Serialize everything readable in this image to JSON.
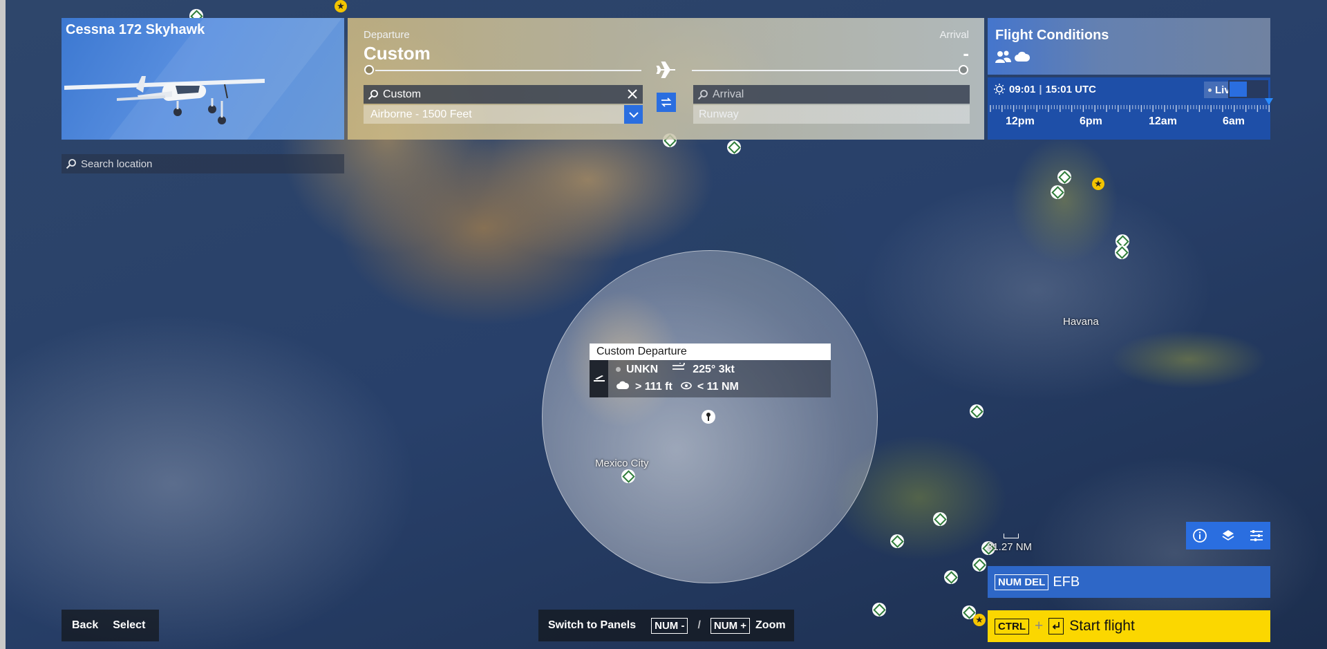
{
  "aircraft": {
    "name": "Cessna 172 Skyhawk"
  },
  "search": {
    "placeholder": "Search location"
  },
  "flight_plan": {
    "departure_label": "Departure",
    "departure_value": "Custom",
    "arrival_label": "Arrival",
    "arrival_value": "-",
    "departure_input_value": "Custom",
    "departure_start": "Airborne - 1500 Feet",
    "arrival_placeholder": "Arrival",
    "arrival_runway": "Runway"
  },
  "conditions": {
    "title": "Flight Conditions",
    "local_time": "09:01",
    "utc_time": "15:01 UTC",
    "live_label": "Live",
    "time_ticks": [
      "12pm",
      "6pm",
      "12am",
      "6am"
    ]
  },
  "popup": {
    "title": "Custom Departure",
    "station": "UNKN",
    "wind": "225° 3kt",
    "ceiling": "> 111 ft",
    "visibility": "< 11 NM"
  },
  "map": {
    "city_mexico": "Mexico City",
    "city_havana": "Havana",
    "scale": "31.27 NM"
  },
  "efb": {
    "key": "NUM DEL",
    "label": "EFB"
  },
  "start": {
    "key1": "CTRL",
    "plus": "+",
    "label": "Start flight"
  },
  "bottom_left": {
    "back": "Back",
    "select": "Select"
  },
  "bottom_center": {
    "switch": "Switch to Panels",
    "key_minus": "NUM -",
    "slash": "/",
    "key_plus": "NUM +",
    "zoom": "Zoom"
  },
  "colors": {
    "accent": "#2a6ee0",
    "start": "#fbd700",
    "timebar": "#1e4fa8"
  }
}
